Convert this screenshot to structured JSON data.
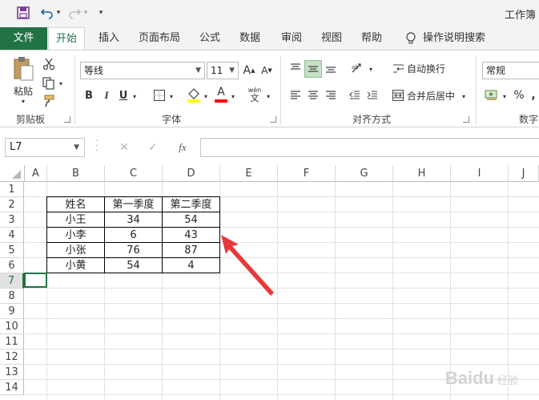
{
  "app": {
    "title": "工作簿"
  },
  "quick_access": {
    "icons": [
      "save-icon",
      "undo-icon",
      "redo-icon",
      "customize-icon"
    ],
    "undo_caret": "▾",
    "redo_caret": "▾",
    "customize_glyph": "▾"
  },
  "tabs": [
    "文件",
    "开始",
    "插入",
    "页面布局",
    "公式",
    "数据",
    "审阅",
    "视图",
    "帮助"
  ],
  "tell_me": "操作说明搜索",
  "ribbon": {
    "clipboard": {
      "paste_label": "粘贴",
      "group_label": "剪贴板"
    },
    "font": {
      "font_name": "等线",
      "font_size": "11",
      "bold": "B",
      "italic": "I",
      "underline": "U",
      "grow": "A",
      "shrink": "A",
      "font_color_letter": "A",
      "phonetic": "wén",
      "phonetic_char": "文",
      "group_label": "字体",
      "highlight_color": "#ffff00",
      "font_color": "#ff0000"
    },
    "alignment": {
      "wrap_text": "自动换行",
      "merge_center": "合并后居中",
      "group_label": "对齐方式"
    },
    "number": {
      "format": "常规",
      "percent": "%",
      "comma": ",",
      "group_label": "数字"
    }
  },
  "formula_bar": {
    "name_box": "L7",
    "cancel": "✕",
    "enter": "✓",
    "fx": "fx",
    "content": ""
  },
  "columns": [
    "A",
    "B",
    "C",
    "D",
    "E",
    "F",
    "G",
    "H",
    "I",
    "J"
  ],
  "rows": [
    "1",
    "2",
    "3",
    "4",
    "5",
    "6",
    "7",
    "8",
    "9",
    "10",
    "11",
    "12",
    "13",
    "14"
  ],
  "table": {
    "headers": [
      "姓名",
      "第一季度",
      "第二季度"
    ],
    "rows": [
      [
        "小王",
        "34",
        "54"
      ],
      [
        "小李",
        "6",
        "43"
      ],
      [
        "小张",
        "76",
        "87"
      ],
      [
        "小黄",
        "54",
        "4"
      ]
    ]
  },
  "colors": {
    "accent": "#217346",
    "arrow": "#e8393a"
  },
  "watermark": {
    "brand": "Baidu",
    "sub": "经验"
  }
}
